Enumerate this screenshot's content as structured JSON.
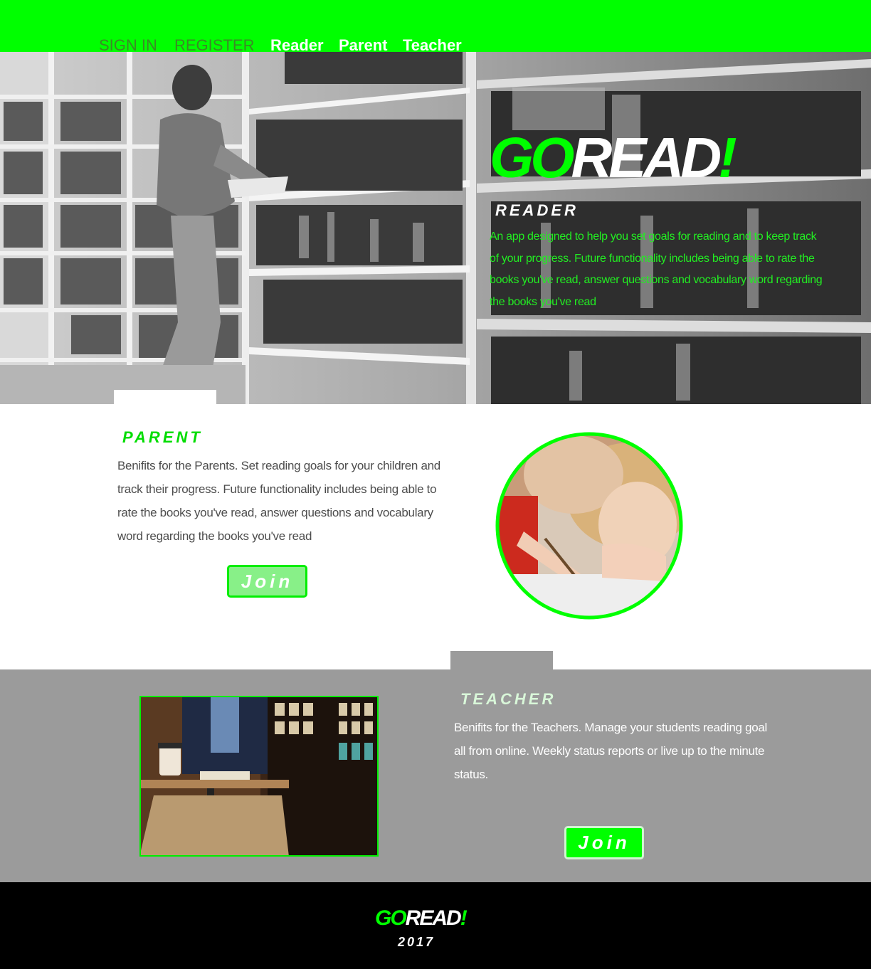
{
  "header": {
    "nav": {
      "sign_in": "SIGN IN",
      "register": "REGISTER",
      "reader": "Reader",
      "parent": "Parent",
      "teacher": "Teacher"
    }
  },
  "hero": {
    "logo_go": "GO",
    "logo_read": "READ",
    "logo_bang": "!",
    "heading": "READER",
    "text": "An app designed to help you set goals for reading and to keep track of your progress. Future functionality includes being able to rate the books you've read, answer questions and vocabulary word regarding the books you've read"
  },
  "parent": {
    "heading": "PARENT",
    "text": "Benifits for the Parents. Set reading goals for your children and track their progress. Future functionality includes being able to rate the books you've read, answer questions and vocabulary word regarding the books you've read",
    "join_label": "Join"
  },
  "teacher": {
    "heading": "TEACHER",
    "text": "Benifits for the Teachers. Manage your students reading goal all from online. Weekly status reports or live up to the minute status.",
    "join_label": "Join"
  },
  "footer": {
    "logo_go": "GO",
    "logo_read": "READ",
    "logo_bang": "!",
    "year": "2017"
  },
  "colors": {
    "brand_green": "#00ff00",
    "teacher_band": "#9b9b9b",
    "footer_bg": "#000000"
  }
}
